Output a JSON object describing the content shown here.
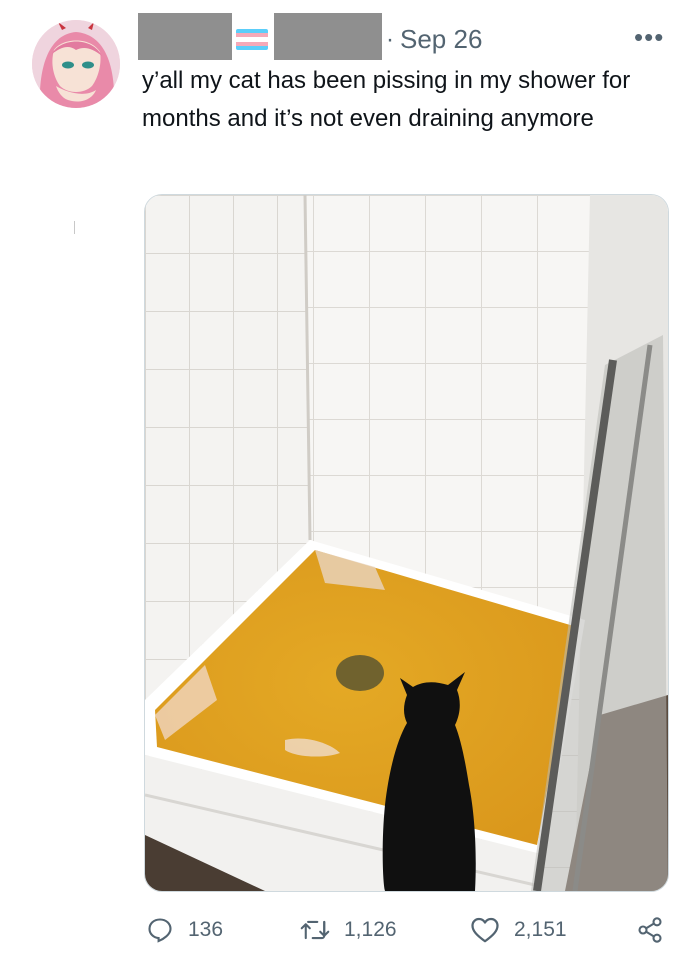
{
  "header": {
    "date_separator": "·",
    "date": "Sep 26",
    "more_label": "•••"
  },
  "tweet": {
    "text": "y’all my cat has been pissing in my shower for months and it’s not even draining anymore"
  },
  "actions": {
    "replies": "136",
    "retweets": "1,126",
    "likes": "2,151"
  },
  "colors": {
    "text_primary": "#0f1419",
    "text_secondary": "#536471",
    "redaction": "#8f8f8f",
    "flag_blue": "#5bcefa",
    "flag_pink": "#f5a9b8",
    "flag_white": "#ffffff"
  },
  "icons": {
    "reply": "reply-icon",
    "retweet": "retweet-icon",
    "like": "heart-icon",
    "share": "share-icon",
    "more": "more-icon"
  }
}
